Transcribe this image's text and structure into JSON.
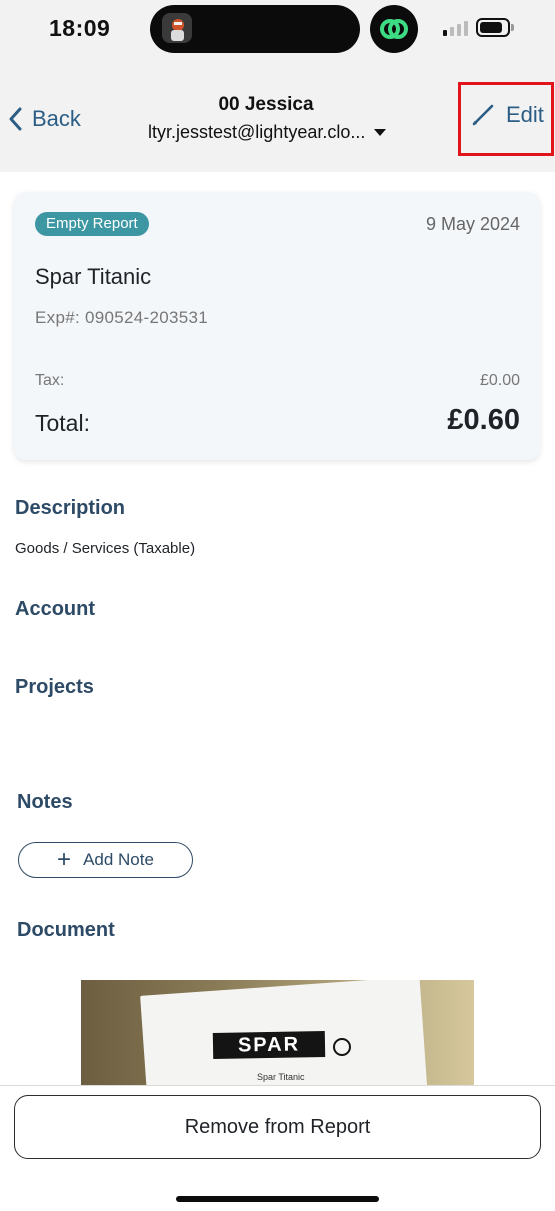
{
  "status_bar": {
    "time": "18:09",
    "icons": [
      "profile-avatar-icon",
      "threads-app-icon",
      "cellular-signal-icon",
      "battery-icon"
    ]
  },
  "header": {
    "back_label": "Back",
    "title": "00 Jessica",
    "account_email": "ltyr.jesstest@lightyear.clo...",
    "edit_label": "Edit"
  },
  "summary": {
    "badge": "Empty Report",
    "date": "9 May 2024",
    "merchant": "Spar Titanic",
    "expense_number": "Exp#: 090524-203531",
    "tax_label": "Tax:",
    "tax_value": "£0.00",
    "total_label": "Total:",
    "total_value": "£0.60"
  },
  "sections": {
    "description_title": "Description",
    "description_value": "Goods / Services (Taxable)",
    "account_title": "Account",
    "projects_title": "Projects",
    "notes_title": "Notes",
    "add_note_label": "Add Note",
    "document_title": "Document"
  },
  "document": {
    "logo_text": "SPAR",
    "receipt_line": "Spar Titanic"
  },
  "footer": {
    "remove_label": "Remove from Report"
  },
  "colors": {
    "accent": "#2b5d85",
    "section_heading": "#2d4a66",
    "badge": "#3d97a3",
    "highlight": "#e2141b"
  }
}
